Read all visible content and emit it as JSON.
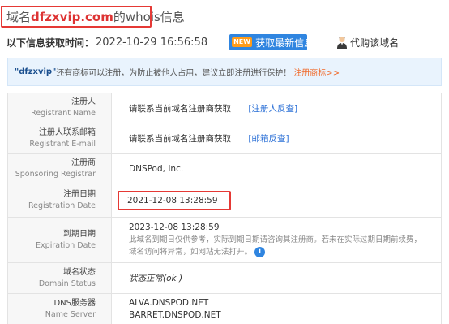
{
  "title": {
    "prefix": "域名",
    "domain": "dfzxvip.com",
    "suffix": "的whois信息"
  },
  "info": {
    "label": "以下信息获取时间：",
    "time": "2022-10-29 16:56:58",
    "new_badge": "NEW",
    "refresh_label": "获取最新信息",
    "buy_label": "代购该域名"
  },
  "notice": {
    "domain": "\"dfzxvip\"",
    "text": " 还有商标可以注册，为防止被他人占用，建议立即注册进行保护！",
    "link": "注册商标>>"
  },
  "rows": {
    "registrant": {
      "cn": "注册人",
      "en": "Registrant Name",
      "value": "请联系当前域名注册商获取",
      "link": "[注册人反查]"
    },
    "email": {
      "cn": "注册人联系邮箱",
      "en": "Registrant E-mail",
      "value": "请联系当前域名注册商获取",
      "link": "[邮箱反查]"
    },
    "registrar": {
      "cn": "注册商",
      "en": "Sponsoring Registrar",
      "value": "DNSPod, Inc."
    },
    "created": {
      "cn": "注册日期",
      "en": "Registration Date",
      "value": "2021-12-08 13:28:59"
    },
    "expires": {
      "cn": "到期日期",
      "en": "Expiration Date",
      "value": "2023-12-08 13:28:59",
      "note1": "此域名到期日仅供参考，实际到期日期请咨询其注册商。若未在实际过期日期前续费，",
      "note2": "域名访问将异常，如网站无法打开。",
      "info_icon": "i"
    },
    "status": {
      "cn": "域名状态",
      "en": "Domain Status",
      "value": "状态正常(ok )"
    },
    "dns": {
      "cn": "DNS服务器",
      "en": "Name Server",
      "ns1": "ALVA.DNSPOD.NET",
      "ns2": "BARRET.DNSPOD.NET"
    }
  },
  "colors": {
    "accent_red": "#e53935",
    "link_blue": "#2a6fd6",
    "button_blue": "#2f85e0",
    "notice_bg": "#e9f3fd",
    "orange": "#f06a2a"
  }
}
